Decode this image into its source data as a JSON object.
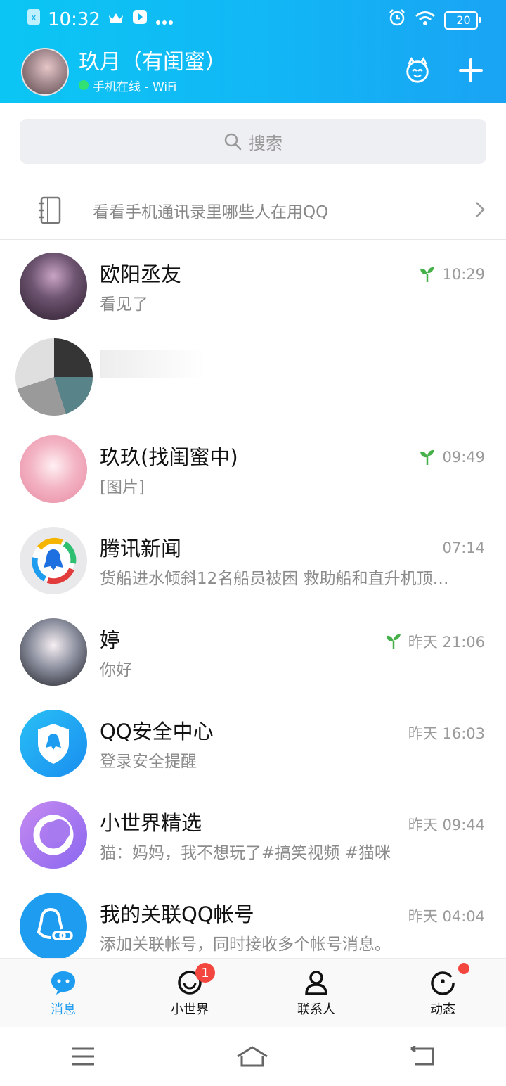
{
  "status_bar": {
    "time": "10:32",
    "battery": "20"
  },
  "header": {
    "user_name": "玖月（有闺蜜）",
    "status": "手机在线 - WiFi"
  },
  "search": {
    "placeholder": "搜索"
  },
  "contacts_tip": {
    "text": "看看手机通讯录里哪些人在用QQ"
  },
  "conversations": [
    {
      "name": "欧阳丞友",
      "preview": "看见了",
      "time": "10:29",
      "sprout": true
    },
    {
      "name": "",
      "preview": "",
      "time": "",
      "sprout": false
    },
    {
      "name": "玖玖(找闺蜜中)",
      "preview": "[图片]",
      "time": "09:49",
      "sprout": true
    },
    {
      "name": "腾讯新闻",
      "preview": "货船进水倾斜12名船员被困 救助船和直升机顶…",
      "time": "07:14",
      "sprout": false
    },
    {
      "name": "婷",
      "preview": "你好",
      "time": "昨天 21:06",
      "sprout": true
    },
    {
      "name": "QQ安全中心",
      "preview": "登录安全提醒",
      "time": "昨天 16:03",
      "sprout": false
    },
    {
      "name": "小世界精选",
      "preview": "猫：妈妈，我不想玩了#搞笑视频 #猫咪",
      "time": "昨天 09:44",
      "sprout": false
    },
    {
      "name": "我的关联QQ帐号",
      "preview": "添加关联帐号，同时接收多个帐号消息。",
      "time": "昨天 04:04",
      "sprout": false
    }
  ],
  "nav": [
    {
      "label": "消息",
      "icon": "message-icon"
    },
    {
      "label": "小世界",
      "icon": "world-icon",
      "badge": "1"
    },
    {
      "label": "联系人",
      "icon": "contacts-icon"
    },
    {
      "label": "动态",
      "icon": "activity-icon"
    }
  ],
  "colors": {
    "accent": "#1e9cf0",
    "header_start": "#0bc6f4",
    "badge": "#f2463f"
  }
}
